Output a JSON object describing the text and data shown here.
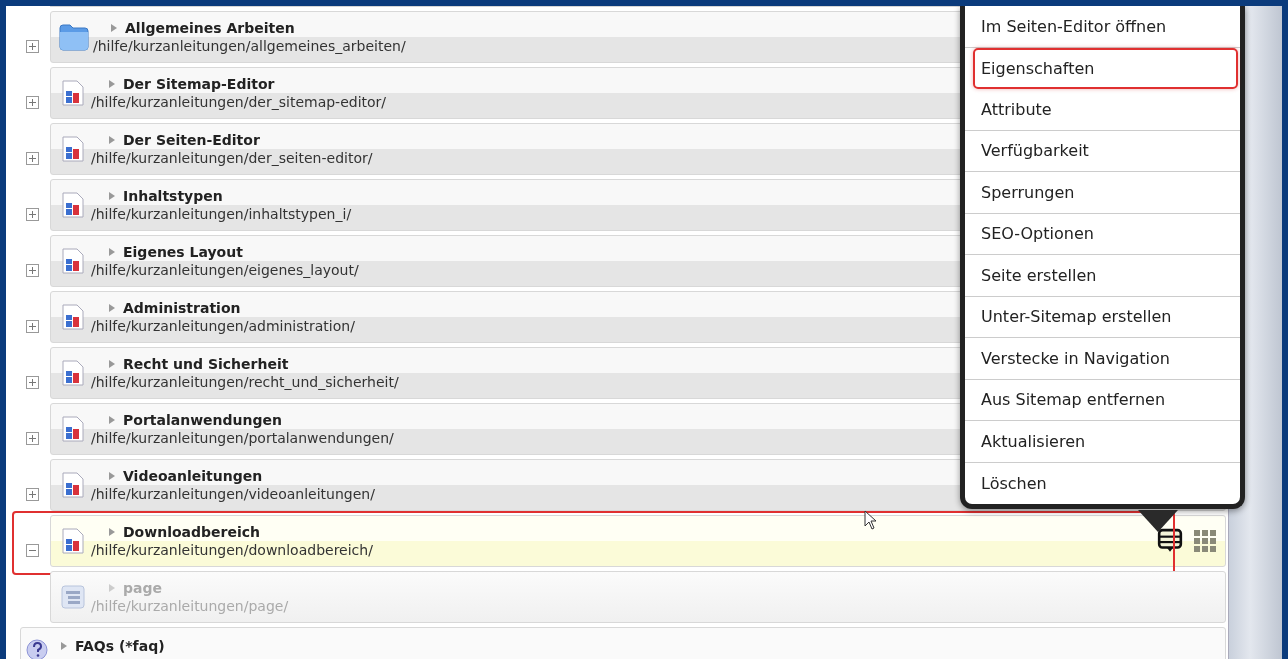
{
  "pages": [
    {
      "kind": "folder",
      "title": "Allgemeines Arbeiten",
      "path": "/hilfe/kurzanleitungen/allgemeines_arbeiten/",
      "expanded": false,
      "selected": false,
      "highlighted": false
    },
    {
      "kind": "page",
      "title": "Der Sitemap-Editor",
      "path": "/hilfe/kurzanleitungen/der_sitemap-editor/",
      "expanded": false,
      "selected": false,
      "highlighted": false
    },
    {
      "kind": "page",
      "title": "Der Seiten-Editor",
      "path": "/hilfe/kurzanleitungen/der_seiten-editor/",
      "expanded": false,
      "selected": false,
      "highlighted": false
    },
    {
      "kind": "page",
      "title": "Inhaltstypen",
      "path": "/hilfe/kurzanleitungen/inhaltstypen_i/",
      "expanded": false,
      "selected": false,
      "highlighted": false
    },
    {
      "kind": "page",
      "title": "Eigenes Layout",
      "path": "/hilfe/kurzanleitungen/eigenes_layout/",
      "expanded": false,
      "selected": false,
      "highlighted": false
    },
    {
      "kind": "page",
      "title": "Administration",
      "path": "/hilfe/kurzanleitungen/administration/",
      "expanded": false,
      "selected": false,
      "highlighted": false
    },
    {
      "kind": "page",
      "title": "Recht und Sicherheit",
      "path": "/hilfe/kurzanleitungen/recht_und_sicherheit/",
      "expanded": false,
      "selected": false,
      "highlighted": false
    },
    {
      "kind": "page",
      "title": "Portalanwendungen",
      "path": "/hilfe/kurzanleitungen/portalanwendungen/",
      "expanded": false,
      "selected": false,
      "highlighted": false
    },
    {
      "kind": "page",
      "title": "Videoanleitungen",
      "path": "/hilfe/kurzanleitungen/videoanleitungen/",
      "expanded": false,
      "selected": false,
      "highlighted": false
    },
    {
      "kind": "page",
      "title": "Downloadbereich",
      "path": "/hilfe/kurzanleitungen/downloadbereich/",
      "expanded": true,
      "selected": true,
      "highlighted": true,
      "children": [
        {
          "kind": "placeholder",
          "title": "page",
          "path": "/hilfe/kurzanleitungen/page/",
          "disabled": true
        }
      ]
    }
  ],
  "faq": {
    "title": "FAQs (*faq)"
  },
  "context_menu": {
    "items": [
      {
        "label": "Im Seiten-Editor öffnen",
        "highlighted": false
      },
      {
        "label": "Eigenschaften",
        "highlighted": true
      },
      {
        "label": "Attribute",
        "highlighted": false
      },
      {
        "label": "Verfügbarkeit",
        "highlighted": false
      },
      {
        "label": "Sperrungen",
        "highlighted": false
      },
      {
        "label": "SEO-Optionen",
        "highlighted": false
      },
      {
        "label": "Seite erstellen",
        "highlighted": false
      },
      {
        "label": "Unter-Sitemap erstellen",
        "highlighted": false
      },
      {
        "label": "Verstecke in Navigation",
        "highlighted": false
      },
      {
        "label": "Aus Sitemap entfernen",
        "highlighted": false
      },
      {
        "label": "Aktualisieren",
        "highlighted": false
      },
      {
        "label": "Löschen",
        "highlighted": false
      }
    ]
  }
}
